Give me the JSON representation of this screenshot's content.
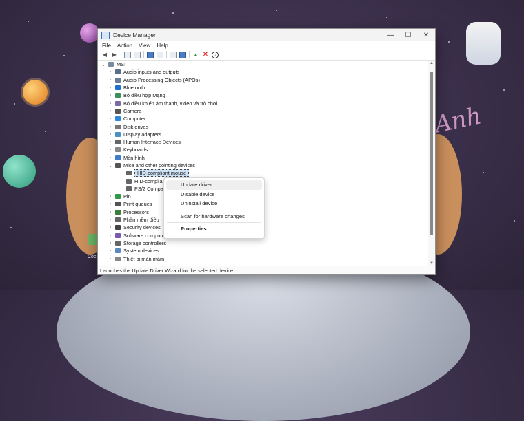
{
  "window": {
    "title": "Device Manager",
    "controls": {
      "minimize": "—",
      "maximize": "☐",
      "close": "✕"
    }
  },
  "menu": [
    "File",
    "Action",
    "View",
    "Help"
  ],
  "tree": {
    "root": "MSI",
    "items": [
      {
        "label": "Audio inputs and outputs",
        "expanded": false
      },
      {
        "label": "Audio Processing Objects (APOs)",
        "expanded": false
      },
      {
        "label": "Bluetooth",
        "expanded": false
      },
      {
        "label": "Bộ điều hợp Mạng",
        "expanded": false
      },
      {
        "label": "Bộ điều khiển âm thanh, video và trò chơi",
        "expanded": false
      },
      {
        "label": "Camera",
        "expanded": false
      },
      {
        "label": "Computer",
        "expanded": false
      },
      {
        "label": "Disk drives",
        "expanded": false
      },
      {
        "label": "Display adapters",
        "expanded": false
      },
      {
        "label": "Human Interface Devices",
        "expanded": false
      },
      {
        "label": "Keyboards",
        "expanded": false
      },
      {
        "label": "Màn hình",
        "expanded": false
      },
      {
        "label": "Mice and other pointing devices",
        "expanded": true
      },
      {
        "label": "HID-compliant mouse",
        "child": true,
        "selected": true
      },
      {
        "label": "HID-complia",
        "child": true
      },
      {
        "label": "PS/2 Compat",
        "child": true
      },
      {
        "label": "Pin",
        "expanded": false
      },
      {
        "label": "Print queues",
        "expanded": false
      },
      {
        "label": "Processors",
        "expanded": false
      },
      {
        "label": "Phần mềm điều",
        "expanded": false
      },
      {
        "label": "Security devices",
        "expanded": false
      },
      {
        "label": "Software components",
        "expanded": false
      },
      {
        "label": "Storage controllers",
        "expanded": false
      },
      {
        "label": "System devices",
        "expanded": false
      },
      {
        "label": "Thiết bị màn màm",
        "expanded": false
      }
    ]
  },
  "context_menu": {
    "update": "Update driver",
    "disable": "Disable device",
    "uninstall": "Uninstall device",
    "scan": "Scan for hardware changes",
    "properties": "Properties"
  },
  "status": "Launches the Update Driver Wizard for the selected device.",
  "desktop": {
    "anh_text": "Anh",
    "icon_label": "Coc"
  }
}
